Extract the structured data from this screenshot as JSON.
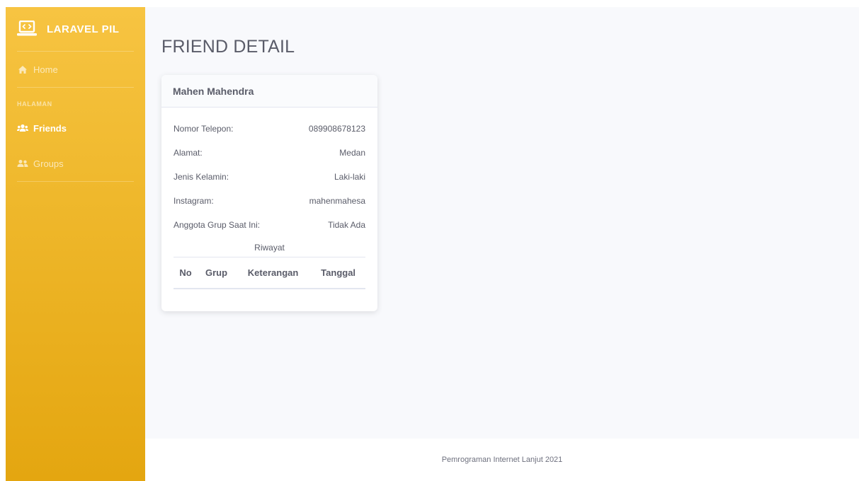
{
  "sidebar": {
    "brand": "LARAVEL PIL",
    "home_label": "Home",
    "section_heading": "HALAMAN",
    "items": [
      {
        "label": "Friends",
        "icon": "users-icon",
        "active": true
      },
      {
        "label": "Groups",
        "icon": "user-friends-icon",
        "active": false
      }
    ]
  },
  "page": {
    "title": "FRIEND DETAIL"
  },
  "card": {
    "name": "Mahen Mahendra",
    "fields": [
      {
        "label": "Nomor Telepon:",
        "value": "089908678123"
      },
      {
        "label": "Alamat:",
        "value": "Medan"
      },
      {
        "label": "Jenis Kelamin:",
        "value": "Laki-laki"
      },
      {
        "label": "Instagram:",
        "value": "mahenmahesa"
      },
      {
        "label": "Anggota Grup Saat Ini:",
        "value": "Tidak Ada"
      }
    ],
    "history_title": "Riwayat",
    "history_columns": [
      "No",
      "Grup",
      "Keterangan",
      "Tanggal"
    ]
  },
  "footer": {
    "text": "Pemrograman Internet Lanjut 2021"
  },
  "colors": {
    "sidebar_top": "#f7c442",
    "sidebar_bottom": "#e4a610",
    "text": "#5a5c69",
    "content_bg": "#f8f9fc"
  }
}
